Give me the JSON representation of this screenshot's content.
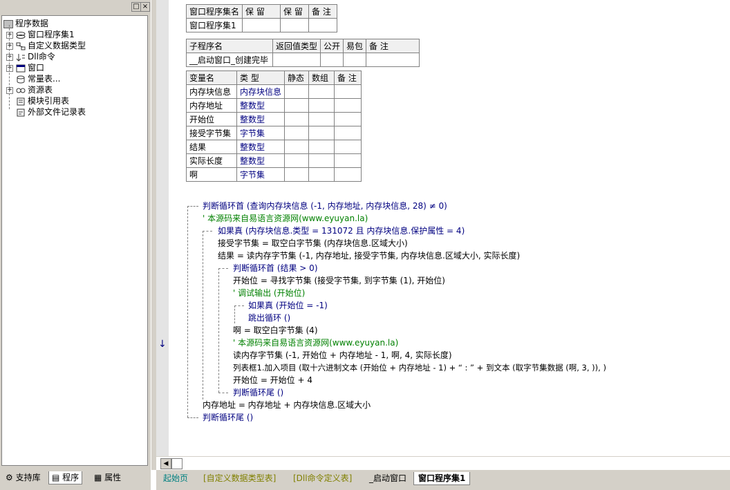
{
  "tree": {
    "root": "程序数据",
    "items": [
      "窗口程序集1",
      "自定义数据类型",
      "Dll命令",
      "窗口",
      "常量表...",
      "资源表",
      "模块引用表",
      "外部文件记录表"
    ]
  },
  "left_tabs": [
    "支持库",
    "程序",
    "属性"
  ],
  "assembly_table": {
    "headers": [
      "窗口程序集名",
      "保 留",
      "保 留",
      "备 注"
    ],
    "row": [
      "窗口程序集1",
      "",
      "",
      ""
    ]
  },
  "sub_table": {
    "headers": [
      "子程序名",
      "返回值类型",
      "公开",
      "易包",
      "备 注"
    ],
    "row": [
      "__启动窗口_创建完毕",
      "",
      "",
      "",
      ""
    ]
  },
  "var_table": {
    "headers": [
      "变量名",
      "类 型",
      "静态",
      "数组",
      "备 注"
    ],
    "rows": [
      [
        "内存块信息",
        "内存块信息"
      ],
      [
        "内存地址",
        "整数型"
      ],
      [
        "开始位",
        "整数型"
      ],
      [
        "接受字节集",
        "字节集"
      ],
      [
        "结果",
        "整数型"
      ],
      [
        "实际长度",
        "整数型"
      ],
      [
        "啊",
        "字节集"
      ]
    ]
  },
  "code": [
    "判断循环首 (查询内存块信息 (-1, 内存地址, 内存块信息, 28) ≠ 0)",
    "' 本源码来自易语言资源网(www.eyuyan.la)",
    "如果真 (内存块信息.类型 = 131072 且 内存块信息.保护属性 = 4)",
    "接受字节集 = 取空白字节集 (内存块信息.区域大小)",
    "结果 = 读内存字节集 (-1, 内存地址, 接受字节集, 内存块信息.区域大小, 实际长度)",
    "判断循环首 (结果 > 0)",
    "开始位 = 寻找字节集 (接受字节集, 到字节集 (1), 开始位)",
    "' 调试输出 (开始位)",
    "如果真 (开始位 = -1)",
    "跳出循环 ()",
    "啊 = 取空白字节集 (4)",
    "' 本源码来自易语言资源网(www.eyuyan.la)",
    "读内存字节集 (-1, 开始位 + 内存地址 - 1, 啊, 4, 实际长度)",
    "列表框1.加入项目 (取十六进制文本 (开始位 + 内存地址 - 1) + “ : ” + 到文本 (取字节集数据 (啊, 3, )), )",
    "开始位 = 开始位 + 4",
    "判断循环尾 ()",
    "内存地址 = 内存地址 + 内存块信息.区域大小",
    "判断循环尾 ()"
  ],
  "code_tabs": [
    "起始页",
    "[自定义数据类型表]",
    "[Dll命令定义表]",
    "_启动窗口",
    "窗口程序集1"
  ]
}
